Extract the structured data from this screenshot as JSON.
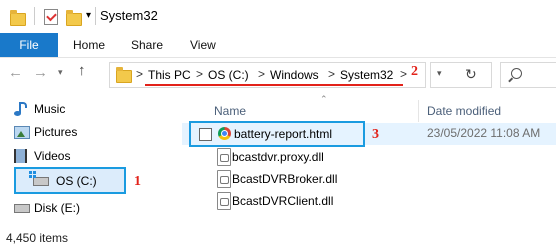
{
  "window": {
    "title": "System32"
  },
  "ribbon": {
    "tabs": [
      "File",
      "Home",
      "Share",
      "View"
    ]
  },
  "address": {
    "crumbs": [
      "This PC",
      "OS (C:)",
      "Windows",
      "System32"
    ],
    "separator": ">",
    "search_icon": "search-icon"
  },
  "sidebar": {
    "items": [
      {
        "label": "Music",
        "icon": "music-icon"
      },
      {
        "label": "Pictures",
        "icon": "pictures-icon"
      },
      {
        "label": "Videos",
        "icon": "videos-icon"
      },
      {
        "label": "OS (C:)",
        "icon": "drive-icon"
      },
      {
        "label": "Disk (E:)",
        "icon": "drive-icon"
      }
    ]
  },
  "columns": {
    "name": "Name",
    "date": "Date modified"
  },
  "files": [
    {
      "name": "battery-report.html",
      "date": "23/05/2022 11:08 AM",
      "icon": "chrome-icon"
    },
    {
      "name": "bcastdvr.proxy.dll",
      "date": "",
      "icon": "dll-icon"
    },
    {
      "name": "BcastDVRBroker.dll",
      "date": "",
      "icon": "dll-icon"
    },
    {
      "name": "BcastDVRClient.dll",
      "date": "",
      "icon": "dll-icon"
    }
  ],
  "annotations": {
    "one": "1",
    "two": "2",
    "three": "3"
  },
  "status": {
    "items_count": "4,450 items"
  },
  "colors": {
    "accent": "#1979ca",
    "highlight_box": "#1a9be0",
    "annotation": "#e2221a"
  }
}
